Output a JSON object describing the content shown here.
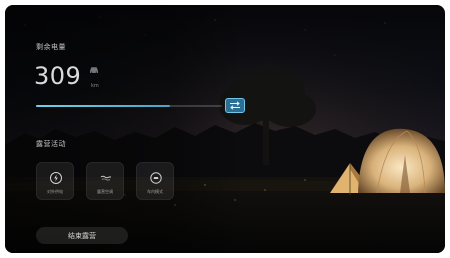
{
  "battery": {
    "title": "剩余电量",
    "range_value": "309",
    "unit": "km",
    "charge_fraction": 0.72
  },
  "camping": {
    "section_title": "露营活动",
    "tiles": [
      {
        "label": "对外供电",
        "icon": "lightning-circle-icon"
      },
      {
        "label": "露营空调",
        "icon": "fan-airflow-icon"
      },
      {
        "label": "车内模式",
        "icon": "car-mode-icon"
      }
    ],
    "end_label": "结束露营"
  },
  "colors": {
    "accent": "#4aa5c4",
    "swap_button": "#2c6f94",
    "tent_glow": "#f1d3a2"
  },
  "icons": {
    "swap": "swap-arrows-icon",
    "car": "car-icon"
  }
}
